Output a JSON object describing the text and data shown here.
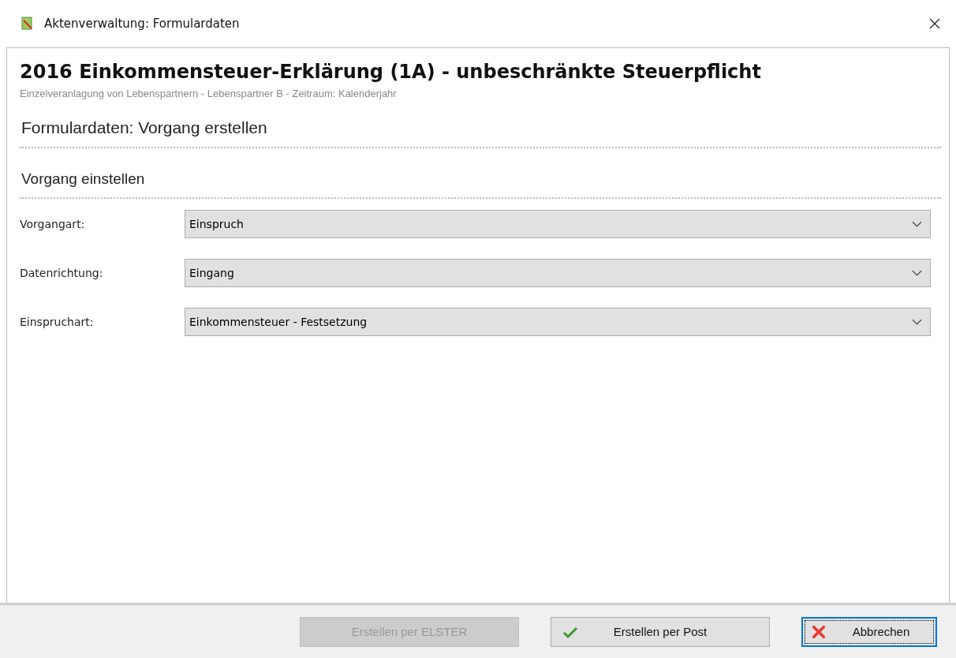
{
  "window": {
    "title": "Aktenverwaltung: Formulardaten"
  },
  "header": {
    "title": "2016 Einkommensteuer-Erklärung (1A) - unbeschränkte Steuerpflicht",
    "subtitle": "Einzelveranlagung von Lebenspartnern - Lebenspartner B - Zeitraum: Kalenderjahr"
  },
  "page_heading": "Formulardaten: Vorgang erstellen",
  "section": {
    "title": "Vorgang einstellen",
    "fields": [
      {
        "label": "Vorgangart:",
        "value": "Einspruch"
      },
      {
        "label": "Datenrichtung:",
        "value": "Eingang"
      },
      {
        "label": "Einspruchart:",
        "value": "Einkommensteuer - Festsetzung"
      }
    ]
  },
  "buttons": [
    {
      "label": "Erstellen per ELSTER",
      "kind": "plain",
      "disabled": true,
      "focused": false
    },
    {
      "label": "Erstellen per Post",
      "kind": "confirm",
      "disabled": false,
      "focused": false
    },
    {
      "label": "Abbrechen",
      "kind": "cancel",
      "disabled": false,
      "focused": true
    }
  ]
}
